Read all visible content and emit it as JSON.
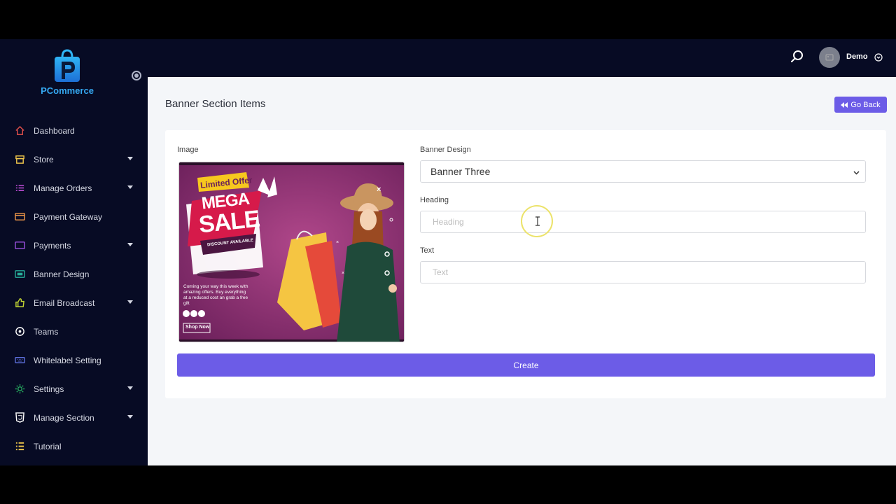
{
  "brand": {
    "name": "PCommerce"
  },
  "sidebar": {
    "items": [
      {
        "label": "Dashboard",
        "icon": "home-icon",
        "color": "#e2504b",
        "has_submenu": false
      },
      {
        "label": "Store",
        "icon": "store-icon",
        "color": "#f2c94c",
        "has_submenu": true
      },
      {
        "label": "Manage Orders",
        "icon": "list-icon",
        "color": "#c04dd8",
        "has_submenu": true
      },
      {
        "label": "Payment Gateway",
        "icon": "card-icon",
        "color": "#f2994a",
        "has_submenu": false
      },
      {
        "label": "Payments",
        "icon": "wallet-icon",
        "color": "#9b51e0",
        "has_submenu": true
      },
      {
        "label": "Banner Design",
        "icon": "banner-icon",
        "color": "#27ae9a",
        "has_submenu": false
      },
      {
        "label": "Email Broadcast",
        "icon": "thumbs-up-icon",
        "color": "#c3d633",
        "has_submenu": true
      },
      {
        "label": "Teams",
        "icon": "circle-dot-icon",
        "color": "#ffffff",
        "has_submenu": false
      },
      {
        "label": "Whitelabel Setting",
        "icon": "keyboard-icon",
        "color": "#5b6dd8",
        "has_submenu": false
      },
      {
        "label": "Settings",
        "icon": "gear-icon",
        "color": "#27ae60",
        "has_submenu": true
      },
      {
        "label": "Manage Section",
        "icon": "html5-icon",
        "color": "#ffffff",
        "has_submenu": true
      },
      {
        "label": "Tutorial",
        "icon": "checklist-icon",
        "color": "#f2c94c",
        "has_submenu": false
      }
    ]
  },
  "topbar": {
    "user_name": "Demo"
  },
  "page": {
    "title": "Banner Section Items",
    "go_back_label": "Go Back"
  },
  "form": {
    "image_label": "Image",
    "banner_design_label": "Banner Design",
    "banner_design_value": "Banner Three",
    "heading_label": "Heading",
    "heading_placeholder": "Heading",
    "text_label": "Text",
    "text_placeholder": "Text",
    "create_label": "Create"
  },
  "banner": {
    "badge": "Limited Offer",
    "headline_1": "MEGA",
    "headline_2": "SALE",
    "ribbon": "DISCOUNT AVAILABLE",
    "body": "Coming your way this week with amazing offers. Buy everything at a reduced cost an grab a free gift",
    "cta": "Shop Now"
  },
  "colors": {
    "accent": "#6c5ce7",
    "sidebar_bg": "#070b24",
    "brand_blue": "#35a9f2"
  }
}
